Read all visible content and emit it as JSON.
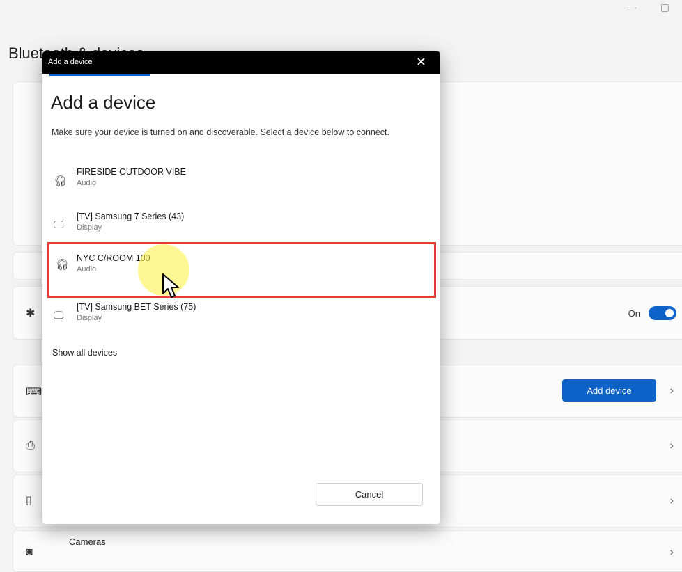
{
  "window": {
    "minimize_glyph": "—",
    "restore_glyph": "▢"
  },
  "page": {
    "title": "Bluetooth & devices"
  },
  "settings": {
    "bluetooth_toggle_label": "On",
    "add_device_button": "Add device",
    "cameras_label": "Cameras",
    "chevron": "›"
  },
  "dialog": {
    "title_bar": "Add a device",
    "heading": "Add a device",
    "description": "Make sure your device is turned on and discoverable. Select a device below to connect.",
    "devices": [
      {
        "name": "FIRESIDE OUTDOOR VIBE",
        "type": "Audio",
        "icon": "headphones-icon"
      },
      {
        "name": "[TV] Samsung 7 Series (43)",
        "type": "Display",
        "icon": "monitor-icon"
      },
      {
        "name": "NYC C/ROOM 100",
        "type": "Audio",
        "icon": "headphones-icon"
      },
      {
        "name": "[TV] Samsung BET Series (75)",
        "type": "Display",
        "icon": "monitor-icon"
      }
    ],
    "show_all": "Show all devices",
    "cancel_button": "Cancel",
    "close_glyph": "✕"
  },
  "colors": {
    "accent": "#0f62c8",
    "highlight_border": "#e53935",
    "cursor_glow": "#fff03c"
  }
}
